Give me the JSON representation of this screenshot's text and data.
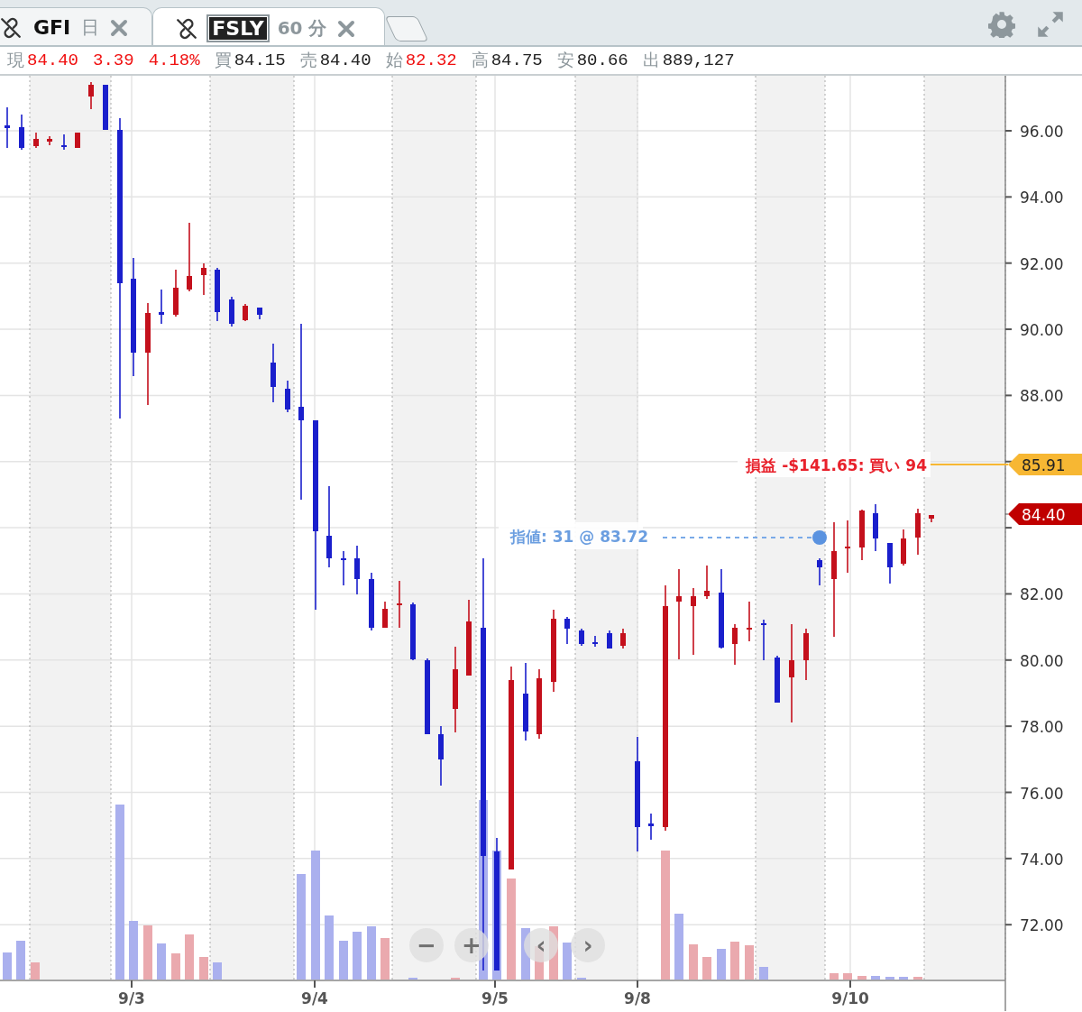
{
  "tabs": [
    {
      "symbol": "GFI",
      "interval": "日",
      "selected": false
    },
    {
      "symbol": "FSLY",
      "interval": "60 分",
      "selected": true
    }
  ],
  "quote_bar": [
    {
      "label": "現",
      "value": "84.40",
      "color": "#f01010"
    },
    {
      "value": "3.39",
      "color": "#f01010"
    },
    {
      "value": "4.18%",
      "color": "#f01010"
    },
    {
      "label": "買",
      "value": "84.15",
      "color": "#222222"
    },
    {
      "label": "売",
      "value": "84.40",
      "color": "#222222"
    },
    {
      "label": "始",
      "value": "82.32",
      "color": "#f01010"
    },
    {
      "label": "高",
      "value": "84.75",
      "color": "#222222"
    },
    {
      "label": "安",
      "value": "80.66",
      "color": "#222222"
    },
    {
      "label": "出",
      "value": "889,127",
      "color": "#222222"
    }
  ],
  "chart": {
    "y_axis_labels": [
      "96.00",
      "94.00",
      "92.00",
      "90.00",
      "88.00",
      "82.00",
      "80.00",
      "78.00",
      "76.00",
      "74.00",
      "72.00"
    ],
    "x_axis_labels": [
      "9/3",
      "9/4",
      "9/5",
      "9/8",
      "9/10"
    ],
    "position_line": {
      "text": "損益 -$141.65: 買い 94",
      "price": "85.91"
    },
    "limit_order": {
      "text": "指値: 31 @ 83.72"
    },
    "last_price": "84.40",
    "nav_buttons": [
      "−",
      "+",
      "‹",
      "›"
    ]
  }
}
